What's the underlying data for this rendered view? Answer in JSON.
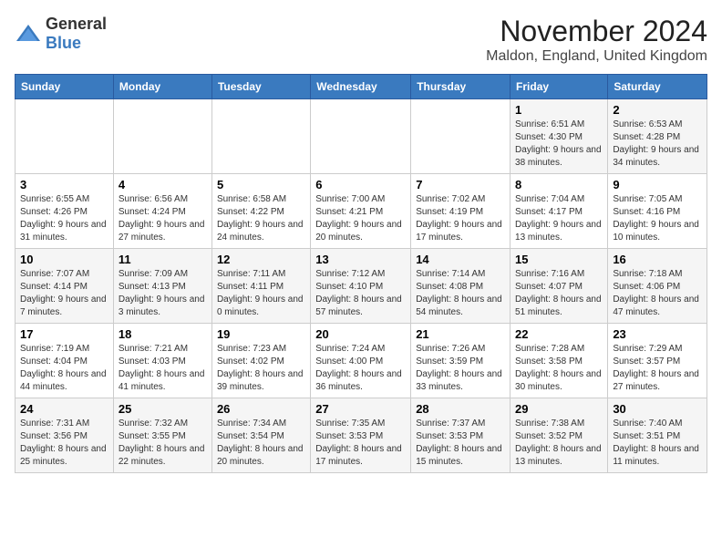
{
  "header": {
    "logo_general": "General",
    "logo_blue": "Blue",
    "month": "November 2024",
    "location": "Maldon, England, United Kingdom"
  },
  "weekdays": [
    "Sunday",
    "Monday",
    "Tuesday",
    "Wednesday",
    "Thursday",
    "Friday",
    "Saturday"
  ],
  "weeks": [
    [
      {
        "day": "",
        "info": ""
      },
      {
        "day": "",
        "info": ""
      },
      {
        "day": "",
        "info": ""
      },
      {
        "day": "",
        "info": ""
      },
      {
        "day": "",
        "info": ""
      },
      {
        "day": "1",
        "info": "Sunrise: 6:51 AM\nSunset: 4:30 PM\nDaylight: 9 hours and 38 minutes."
      },
      {
        "day": "2",
        "info": "Sunrise: 6:53 AM\nSunset: 4:28 PM\nDaylight: 9 hours and 34 minutes."
      }
    ],
    [
      {
        "day": "3",
        "info": "Sunrise: 6:55 AM\nSunset: 4:26 PM\nDaylight: 9 hours and 31 minutes."
      },
      {
        "day": "4",
        "info": "Sunrise: 6:56 AM\nSunset: 4:24 PM\nDaylight: 9 hours and 27 minutes."
      },
      {
        "day": "5",
        "info": "Sunrise: 6:58 AM\nSunset: 4:22 PM\nDaylight: 9 hours and 24 minutes."
      },
      {
        "day": "6",
        "info": "Sunrise: 7:00 AM\nSunset: 4:21 PM\nDaylight: 9 hours and 20 minutes."
      },
      {
        "day": "7",
        "info": "Sunrise: 7:02 AM\nSunset: 4:19 PM\nDaylight: 9 hours and 17 minutes."
      },
      {
        "day": "8",
        "info": "Sunrise: 7:04 AM\nSunset: 4:17 PM\nDaylight: 9 hours and 13 minutes."
      },
      {
        "day": "9",
        "info": "Sunrise: 7:05 AM\nSunset: 4:16 PM\nDaylight: 9 hours and 10 minutes."
      }
    ],
    [
      {
        "day": "10",
        "info": "Sunrise: 7:07 AM\nSunset: 4:14 PM\nDaylight: 9 hours and 7 minutes."
      },
      {
        "day": "11",
        "info": "Sunrise: 7:09 AM\nSunset: 4:13 PM\nDaylight: 9 hours and 3 minutes."
      },
      {
        "day": "12",
        "info": "Sunrise: 7:11 AM\nSunset: 4:11 PM\nDaylight: 9 hours and 0 minutes."
      },
      {
        "day": "13",
        "info": "Sunrise: 7:12 AM\nSunset: 4:10 PM\nDaylight: 8 hours and 57 minutes."
      },
      {
        "day": "14",
        "info": "Sunrise: 7:14 AM\nSunset: 4:08 PM\nDaylight: 8 hours and 54 minutes."
      },
      {
        "day": "15",
        "info": "Sunrise: 7:16 AM\nSunset: 4:07 PM\nDaylight: 8 hours and 51 minutes."
      },
      {
        "day": "16",
        "info": "Sunrise: 7:18 AM\nSunset: 4:06 PM\nDaylight: 8 hours and 47 minutes."
      }
    ],
    [
      {
        "day": "17",
        "info": "Sunrise: 7:19 AM\nSunset: 4:04 PM\nDaylight: 8 hours and 44 minutes."
      },
      {
        "day": "18",
        "info": "Sunrise: 7:21 AM\nSunset: 4:03 PM\nDaylight: 8 hours and 41 minutes."
      },
      {
        "day": "19",
        "info": "Sunrise: 7:23 AM\nSunset: 4:02 PM\nDaylight: 8 hours and 39 minutes."
      },
      {
        "day": "20",
        "info": "Sunrise: 7:24 AM\nSunset: 4:00 PM\nDaylight: 8 hours and 36 minutes."
      },
      {
        "day": "21",
        "info": "Sunrise: 7:26 AM\nSunset: 3:59 PM\nDaylight: 8 hours and 33 minutes."
      },
      {
        "day": "22",
        "info": "Sunrise: 7:28 AM\nSunset: 3:58 PM\nDaylight: 8 hours and 30 minutes."
      },
      {
        "day": "23",
        "info": "Sunrise: 7:29 AM\nSunset: 3:57 PM\nDaylight: 8 hours and 27 minutes."
      }
    ],
    [
      {
        "day": "24",
        "info": "Sunrise: 7:31 AM\nSunset: 3:56 PM\nDaylight: 8 hours and 25 minutes."
      },
      {
        "day": "25",
        "info": "Sunrise: 7:32 AM\nSunset: 3:55 PM\nDaylight: 8 hours and 22 minutes."
      },
      {
        "day": "26",
        "info": "Sunrise: 7:34 AM\nSunset: 3:54 PM\nDaylight: 8 hours and 20 minutes."
      },
      {
        "day": "27",
        "info": "Sunrise: 7:35 AM\nSunset: 3:53 PM\nDaylight: 8 hours and 17 minutes."
      },
      {
        "day": "28",
        "info": "Sunrise: 7:37 AM\nSunset: 3:53 PM\nDaylight: 8 hours and 15 minutes."
      },
      {
        "day": "29",
        "info": "Sunrise: 7:38 AM\nSunset: 3:52 PM\nDaylight: 8 hours and 13 minutes."
      },
      {
        "day": "30",
        "info": "Sunrise: 7:40 AM\nSunset: 3:51 PM\nDaylight: 8 hours and 11 minutes."
      }
    ]
  ]
}
